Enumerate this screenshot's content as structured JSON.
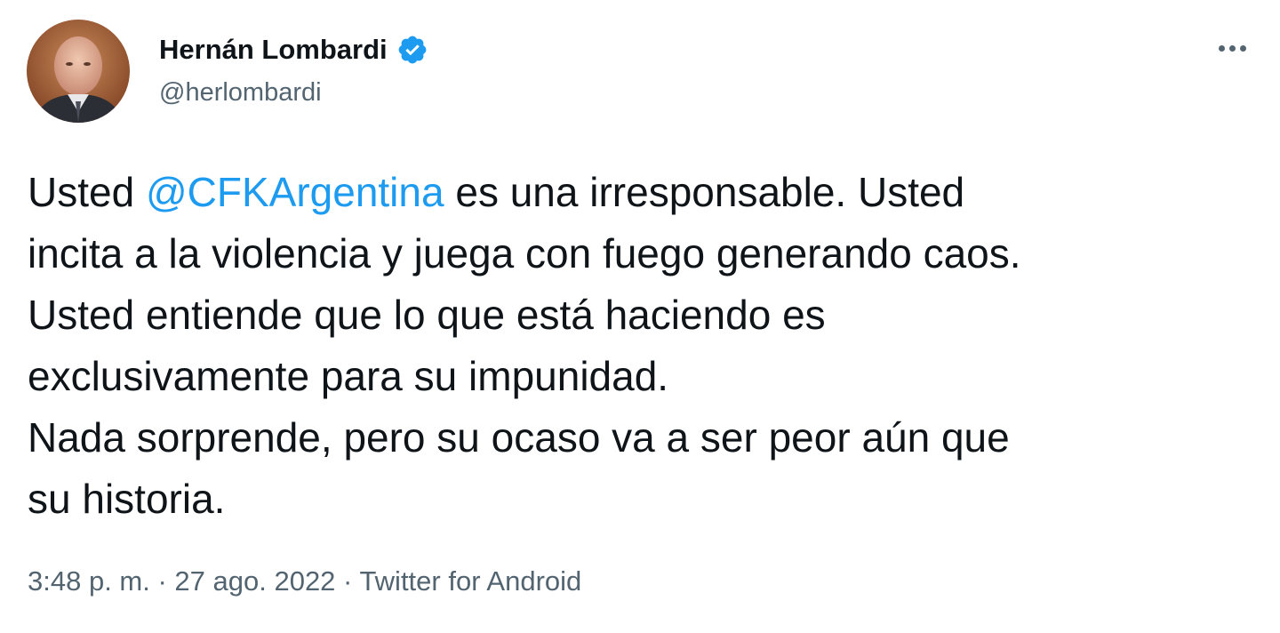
{
  "author": {
    "display_name": "Hernán Lombardi",
    "handle": "@herlombardi",
    "verified": true,
    "avatar_icon": "profile-photo"
  },
  "tweet": {
    "lines": [
      {
        "before": "Usted ",
        "mention": "@CFKArgentina",
        "after": " es una irresponsable. Usted"
      },
      {
        "text": "incita a la violencia y juega con fuego generando caos."
      },
      {
        "text": "Usted entiende que lo que está haciendo es"
      },
      {
        "text": "exclusivamente para su impunidad."
      },
      {
        "text": "Nada sorprende, pero su ocaso va a ser peor aún que"
      },
      {
        "text": "su historia."
      }
    ]
  },
  "meta": {
    "time": "3:48 p. m.",
    "separator": " · ",
    "date": "27 ago. 2022",
    "source": "Twitter for Android"
  },
  "colors": {
    "mention": "#1d9bf0",
    "verified_badge": "#1d9bf0",
    "secondary_text": "#536471",
    "primary_text": "#0f1419"
  },
  "icons": {
    "verified": "verified-badge-icon",
    "more": "more-options-icon"
  }
}
